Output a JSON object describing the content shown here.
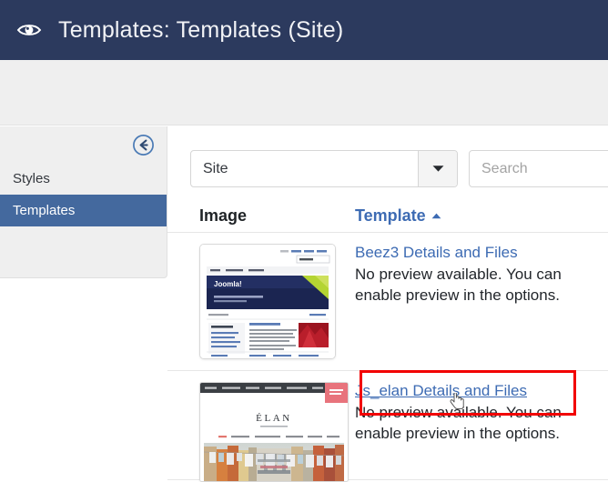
{
  "header": {
    "icon": "eye-icon",
    "title": "Templates: Templates (Site)",
    "background_color": "#2c3a5e",
    "text_color": "#f2f3f6"
  },
  "sidebar": {
    "back_icon": "circle-arrow-left-icon",
    "items": [
      {
        "label": "Styles",
        "active": false
      },
      {
        "label": "Templates",
        "active": true
      }
    ],
    "active_color": "#44699e",
    "background_color": "#efefef"
  },
  "filters": {
    "type_select": {
      "value": "Site",
      "caret_icon": "chevron-down-icon"
    },
    "search": {
      "value": "",
      "placeholder": "Search"
    }
  },
  "table": {
    "columns": [
      {
        "key": "image",
        "label": "Image",
        "sortable": false,
        "color": "#1f2326"
      },
      {
        "key": "template",
        "label": "Template",
        "sortable": true,
        "sort_direction": "asc",
        "color": "#3d6bb3"
      }
    ],
    "rows": [
      {
        "thumbnail": "beez3-template-preview",
        "link_label": "Beez3 Details and Files",
        "description": "No preview available. You can enable preview in the options.",
        "hovered": false,
        "highlighted": false
      },
      {
        "thumbnail": "js-elan-template-preview",
        "link_label": "Js_elan Details and Files",
        "description": "No preview available. You can enable preview in the options.",
        "hovered": true,
        "highlighted": true
      }
    ]
  },
  "annotation": {
    "highlight_color": "#f20000",
    "cursor_icon": "pointer-hand-cursor"
  }
}
